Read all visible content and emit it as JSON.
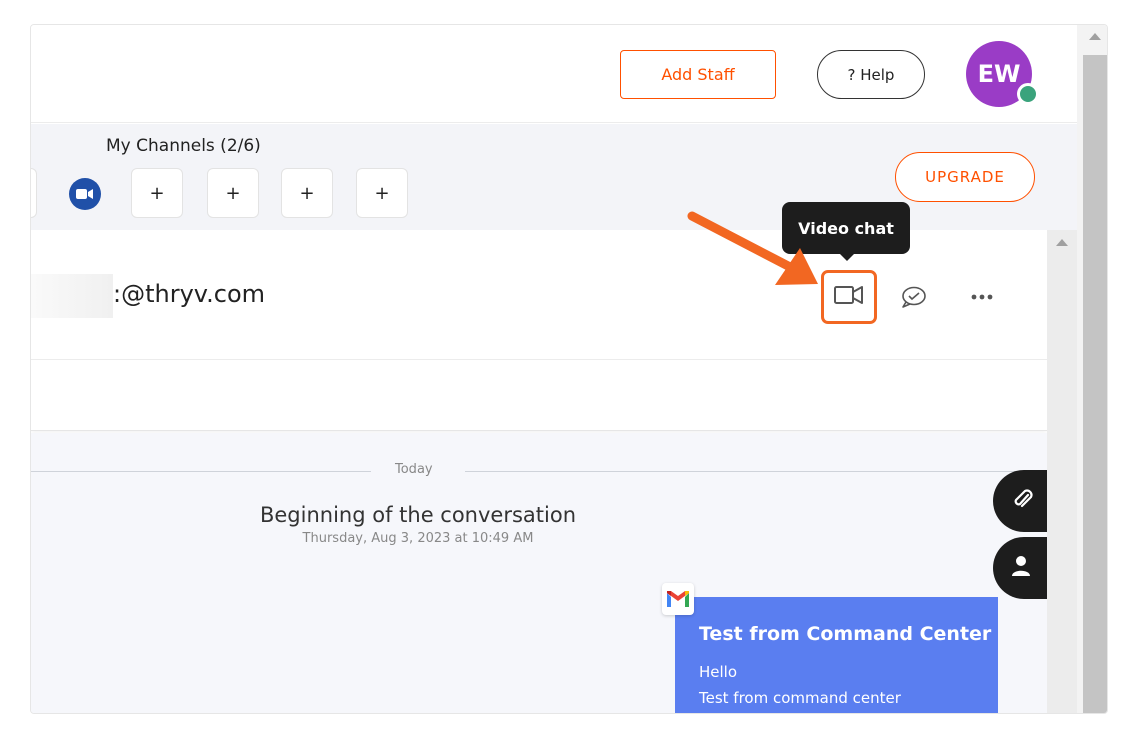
{
  "header": {
    "add_staff_label": "Add Staff",
    "help_label": "? Help",
    "avatar_initials": "EW"
  },
  "channels": {
    "label": "My Channels (2/6)",
    "add_slots": [
      "+",
      "+",
      "+",
      "+"
    ],
    "upgrade_label": "UPGRADE"
  },
  "contact": {
    "email": ":@thryv.com"
  },
  "tooltip": {
    "text": "Video chat"
  },
  "conversation": {
    "day_label": "Today",
    "begin_title": "Beginning of the conversation",
    "begin_date": "Thursday, Aug 3, 2023 at 10:49 AM",
    "message": {
      "title": "Test from Command Center",
      "line1": "Hello",
      "line2": "Test from command center"
    }
  },
  "colors": {
    "brand": "#ff5000",
    "avatar": "#9a3cc6",
    "message_bg": "#5a7ef0",
    "highlight": "#f26722"
  },
  "icons": {
    "video": "video-camera-icon",
    "sms": "chat-bubble-icon",
    "more": "more-horizontal-icon",
    "attach": "paperclip-icon",
    "contact": "person-icon",
    "gmail": "gmail-icon",
    "zoom": "zoom-icon"
  }
}
